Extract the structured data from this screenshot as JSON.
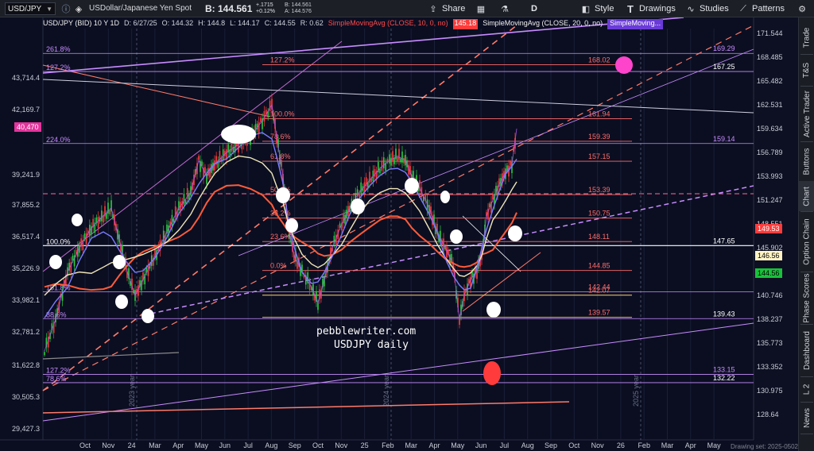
{
  "toolbar": {
    "symbol": "USD/JPY",
    "description": "USDollar/Japanese Yen Spot",
    "bid_label": "B: 144.561",
    "change_top": "+.1715",
    "change_bottom": "+0.12%",
    "bid_small": "B: 144.561",
    "ask_small": "A: 144.576",
    "share_label": "Share",
    "interval_label": "D",
    "style_label": "Style",
    "drawings_label": "Drawings",
    "studies_label": "Studies",
    "patterns_label": "Patterns",
    "icons": {
      "share": "share-icon",
      "grid": "grid-icon",
      "flask": "flask-icon",
      "drawings": "text-tool-icon",
      "studies": "studies-icon",
      "patterns": "patterns-icon",
      "settings": "settings-icon"
    }
  },
  "chart_header": {
    "symbol": "USD/JPY (BID) 10 Y 1D",
    "date": "D: 6/27/25",
    "open": "O: 144.32",
    "high": "H: 144.8",
    "low": "L: 144.17",
    "close": "C: 144.55",
    "range": "R: 0.62",
    "sma_red": "SimpleMovingAvg (CLOSE, 10, 0, no)",
    "sma_red_value": "145.18",
    "sma_white": "SimpleMovingAvg (CLOSE, 20, 0, no)",
    "sma_purple": "SimpleMoving..."
  },
  "sidebar": {
    "tabs": [
      "Trade",
      "T&S",
      "Active Trader",
      "Buttons",
      "Chart",
      "Option Chain",
      "Phase Scores",
      "Dashboard",
      "L 2",
      "News"
    ],
    "active": "Chart"
  },
  "chart_data": {
    "type": "candlestick",
    "left_axis_ticks": [
      "43,714.4",
      "42,169.7",
      "40,470",
      "39,241.9",
      "37,855.2",
      "36,517.4",
      "35,226.9",
      "33,982.1",
      "32,781.2",
      "31,622.8",
      "30,505.3",
      "29,427.3"
    ],
    "right_axis_ticks": [
      "171.544",
      "168.485",
      "165.482",
      "162.531",
      "159.634",
      "156.789",
      "153.993",
      "151.247",
      "148.551",
      "145.902",
      "143.301",
      "140.746",
      "138.237",
      "135.773",
      "133.352",
      "130.975",
      "128.64"
    ],
    "right_axis_range": [
      128.64,
      171.544
    ],
    "x_ticks": [
      "Oct",
      "Nov",
      "24",
      "Mar",
      "Apr",
      "May",
      "Jun",
      "Jul",
      "Aug",
      "Sep",
      "Oct",
      "Nov",
      "25",
      "Feb",
      "Mar",
      "Apr",
      "May",
      "Jun",
      "Jul",
      "Aug",
      "Sep",
      "Oct",
      "Nov",
      "26",
      "Feb",
      "Mar",
      "Apr",
      "May"
    ],
    "year_markers": [
      "2023 year",
      "2024 year",
      "2025 year"
    ],
    "fib_left": [
      {
        "label": "261.8%",
        "price": 169.29
      },
      {
        "label": "127.2%",
        "price": 167.25
      },
      {
        "label": "224.0%",
        "price": 159.14
      },
      {
        "label": "100.0%",
        "price": 147.65
      },
      {
        "label": "161.8%",
        "price": 142.44
      },
      {
        "label": "88.6%",
        "price": 139.43
      },
      {
        "label": "127.2%",
        "price": 133.15
      },
      {
        "label": "78.6%",
        "price": 132.22
      }
    ],
    "fib_mid": [
      {
        "label": "127.2%",
        "price": 168.02
      },
      {
        "label": "100.0%",
        "price": 161.94
      },
      {
        "label": "78.6%",
        "price": 159.39
      },
      {
        "label": "61.8%",
        "price": 157.15
      },
      {
        "label": "50.0%",
        "price": 153.39
      },
      {
        "label": "38.2%",
        "price": 150.75
      },
      {
        "label": "23.6%",
        "price": 148.11
      },
      {
        "label": "0.0%",
        "price": 144.85
      }
    ],
    "fib_mid_extra": [
      {
        "label": "",
        "price": 142.07
      },
      {
        "label": "",
        "price": 139.57
      }
    ],
    "right_labels": [
      {
        "text": "169.29",
        "price": 169.29
      },
      {
        "text": "167.25",
        "price": 167.25
      },
      {
        "text": "159.14",
        "price": 159.14
      },
      {
        "text": "147.65",
        "price": 147.65
      },
      {
        "text": "139.43",
        "price": 139.43
      },
      {
        "text": "133.15",
        "price": 133.15
      },
      {
        "text": "132.22",
        "price": 132.22
      }
    ],
    "mid_labels": [
      {
        "text": "168.02",
        "price": 168.02
      },
      {
        "text": "161.94",
        "price": 161.94
      },
      {
        "text": "159.39",
        "price": 159.39
      },
      {
        "text": "157.15",
        "price": 157.15
      },
      {
        "text": "153.39",
        "price": 153.39
      },
      {
        "text": "150.75",
        "price": 150.75
      },
      {
        "text": "148.11",
        "price": 148.11
      },
      {
        "text": "144.85",
        "price": 144.85
      },
      {
        "text": "142.44",
        "price": 142.44
      },
      {
        "text": "142.07",
        "price": 142.07
      },
      {
        "text": "139.57",
        "price": 139.57
      }
    ],
    "badges": [
      {
        "text": "149.53",
        "bg": "#ff3b3b",
        "fg": "#ffffff",
        "price": 149.53
      },
      {
        "text": "146.56",
        "bg": "#fff3c4",
        "fg": "#000000",
        "price": 146.56
      },
      {
        "text": "144.56",
        "bg": "#18c23a",
        "fg": "#000000",
        "price": 144.56
      }
    ],
    "left_badge": {
      "text": "40,470",
      "bg": "#e4349c"
    },
    "annotation": [
      "pebblewriter.com",
      "USDJPY daily"
    ],
    "colors": {
      "background": "#0b0e21",
      "sma10": "#ff5b3a",
      "sma20": "#f0e6b8",
      "sma50": "#7a7cff",
      "fib_mid": "#ff6b6b",
      "fib_left": "#c78cff",
      "channel": "#ff7a6a",
      "up_candle": "#2ecc40",
      "down_candle": "#ff3b3b",
      "target_dot": "#ff44cc",
      "target_red": "#ff3b3b"
    }
  },
  "footer": {
    "drawing_set": "Drawing set: 2025-0502"
  }
}
